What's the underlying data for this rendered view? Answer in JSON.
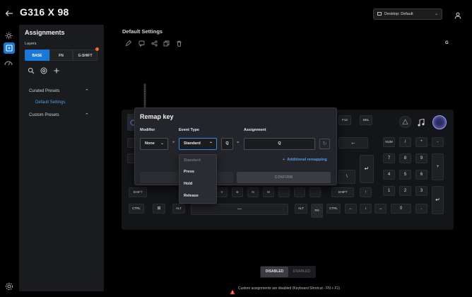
{
  "header": {
    "back_icon": "back-arrow-icon",
    "title": "G316 X 98",
    "profile_select": "Desktop: Default",
    "user_icon": "user-icon"
  },
  "rail": {
    "icons": [
      "lighting-icon",
      "assignments-icon",
      "performance-icon",
      "settings-icon"
    ]
  },
  "panel": {
    "title": "Assignments",
    "layers_label": "Layers",
    "layers": [
      "BASE",
      "FN",
      "G-SHIFT"
    ],
    "curated_label": "Curated Presets",
    "default_preset": "Default Settings",
    "custom_label": "Custom Presets"
  },
  "main": {
    "title": "Default Settings",
    "indicator": "G"
  },
  "keyboard": {
    "keys": {
      "f12": "F12",
      "del": "DEL",
      "num": "NUM",
      "slash": "/",
      "star": "*",
      "minus": "-",
      "seven": "7",
      "eight": "8",
      "nine": "9",
      "plus": "+",
      "four": "4",
      "five": "5",
      "six": "6",
      "one": "1",
      "two": "2",
      "three": "3",
      "zero": "0",
      "dot": ".",
      "backspace": "←",
      "backslash": "\\",
      "enter": "↵",
      "numenter": "↵",
      "v": "V",
      "b": "B",
      "n": "N",
      "m": "M",
      "lshift": "SHIFT",
      "rshift": "SHIFT",
      "lctrl": "CTRL",
      "win": "⊞",
      "lalt": "ALT",
      "ralt": "ALT",
      "fn": "FN",
      "rctrl": "CTRL",
      "space": "—",
      "up": "↑",
      "left": "←",
      "down": "↓",
      "right": "→"
    }
  },
  "dialog": {
    "title": "Remap key",
    "modifier_label": "Modifier",
    "modifier_value": "None",
    "event_label": "Event Type",
    "event_value": "Standard",
    "key_value": "Q",
    "assignment_label": "Assignment",
    "assignment_value": "Q",
    "plus": "+",
    "additional": "Additional remapping",
    "confirm": "CONFIRM",
    "options": [
      "Standard",
      "Press",
      "Hold",
      "Release"
    ]
  },
  "footer": {
    "disabled": "DISABLED",
    "enabled": "ENABLED",
    "warning": "Custom assignments are disabled (Keyboard Shortcut - FN + F1)"
  },
  "colors": {
    "accent": "#1a78d6",
    "link": "#4d9fea",
    "notification": "#ef6c2a",
    "warning": "#e0443a"
  }
}
